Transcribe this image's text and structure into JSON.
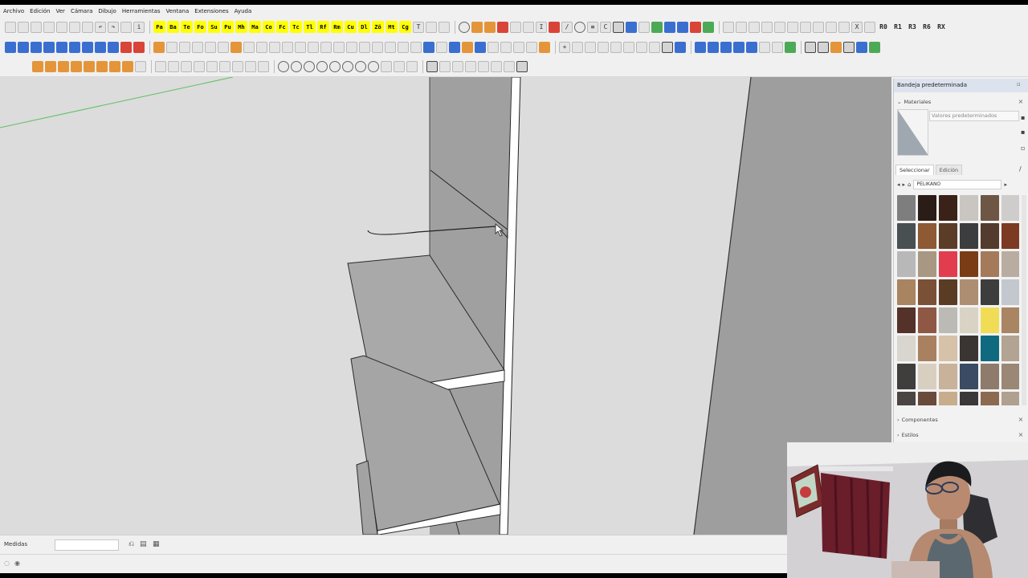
{
  "menu": [
    "Archivo",
    "Edición",
    "Ver",
    "Cámara",
    "Dibujo",
    "Herramientas",
    "Ventana",
    "Extensiones",
    "Ayuda"
  ],
  "toolbar_row1": {
    "yellow_labels": [
      "Pa",
      "Ba",
      "Te",
      "Fo",
      "Su",
      "Pu",
      "Mh",
      "Ma",
      "Co",
      "Fc",
      "Tc",
      "Tl",
      "Rf",
      "Rm",
      "Cu",
      "Dl",
      "Zö",
      "Mt",
      "Cg"
    ],
    "right_labels": [
      "R0",
      "R1",
      "R3",
      "R6",
      "RX"
    ]
  },
  "tray": {
    "title": "Bandeja predeterminada",
    "materials_header": "Materiales",
    "material_name": "Valores predeterminados",
    "tab_select": "Seleccionar",
    "tab_edit": "Edición",
    "library": "PELIKANO",
    "components_header": "Componentes",
    "styles_header": "Estilos",
    "swatch_colors": [
      "#7e7e7e",
      "#2a1c16",
      "#3a2218",
      "#c9c5c1",
      "#6e5645",
      "#cfcdcc",
      "#495052",
      "#8d5a34",
      "#5b3d27",
      "#3c3d3e",
      "#533b2e",
      "#7c3a22",
      "#b8b8b8",
      "#a89883",
      "#e23d4e",
      "#7a3c14",
      "#a47a5a",
      "#b9ada2",
      "#a98460",
      "#7a5036",
      "#5a3c24",
      "#ad8e73",
      "#3d3d3d",
      "#c3c8ce",
      "#54322a",
      "#8e5844",
      "#bbbab5",
      "#d8d3c4",
      "#f0dd55",
      "#a98563",
      "#d8d6cf",
      "#a98060",
      "#d6c2a8",
      "#3a3533",
      "#0f6a80",
      "#b2a393",
      "#3f3e3d",
      "#d8cfc1",
      "#c9b29a",
      "#3a4b63",
      "#8e7b6b",
      "#9b8776",
      "#4a4442",
      "#6a4a3a",
      "#c8ad8d",
      "#3a3838",
      "#8c6a50",
      "#b0a090"
    ]
  },
  "measurements": {
    "label": "Medidas",
    "value": ""
  }
}
